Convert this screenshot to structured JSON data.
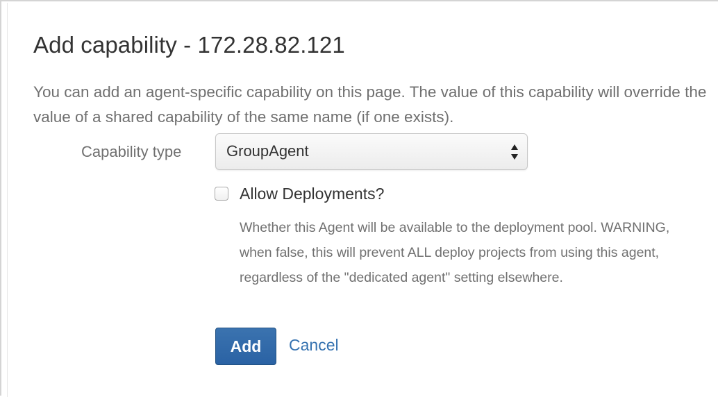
{
  "dialog": {
    "title": "Add capability - 172.28.82.121",
    "description": "You can add an agent-specific capability on this page. The value of this capability will override the value of a shared capability of the same name (if one exists)."
  },
  "form": {
    "capability_type": {
      "label": "Capability type",
      "selected": "GroupAgent"
    },
    "allow_deployments": {
      "label": "Allow Deployments?",
      "checked": false,
      "help": "Whether this Agent will be available to the deployment pool. WARNING, when false, this will prevent ALL deploy projects from using this agent, regardless of the \"dedicated agent\" setting elsewhere."
    },
    "actions": {
      "add_label": "Add",
      "cancel_label": "Cancel"
    }
  },
  "icons": {
    "select_arrows": "up-down-arrows-icon"
  },
  "colors": {
    "primary_button": "#3b73af",
    "link": "#3572b0",
    "text": "#333333",
    "muted_text": "#707070"
  }
}
